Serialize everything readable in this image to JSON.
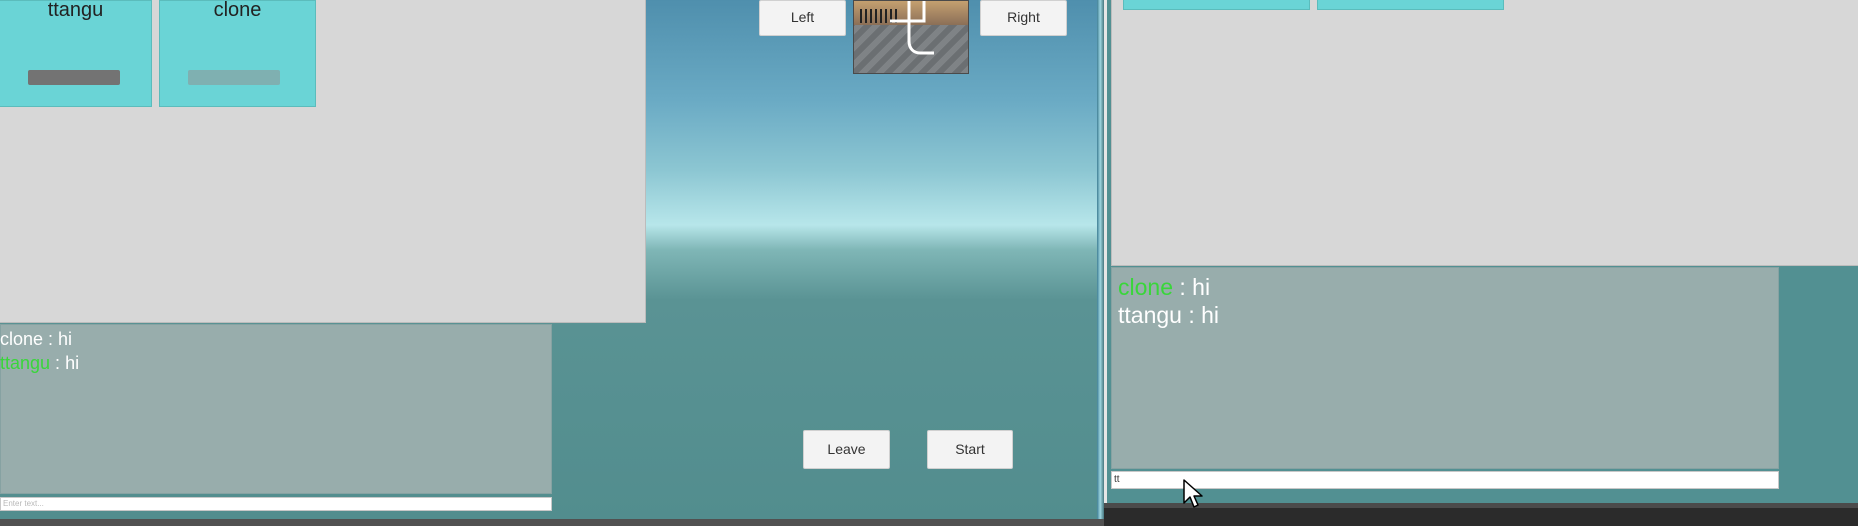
{
  "left_window": {
    "players": [
      {
        "name": "ttangu",
        "bar_color": "#737373"
      },
      {
        "name": "clone",
        "bar_color": "#7fb0b1"
      }
    ],
    "buttons": {
      "left": "Left",
      "right": "Right",
      "leave": "Leave",
      "start": "Start"
    },
    "chat": {
      "messages": [
        {
          "user": "clone",
          "sep": " : ",
          "text": "hi",
          "user_color": "#ffffff"
        },
        {
          "user": "ttangu",
          "sep": " : ",
          "text": "hi",
          "user_color": "#39d63a"
        }
      ],
      "input_placeholder": "Enter text..."
    }
  },
  "right_window": {
    "chat": {
      "messages": [
        {
          "user": "clone",
          "sep": " : ",
          "text": "hi",
          "user_color": "#39d63a"
        },
        {
          "user": "ttangu",
          "sep": " : ",
          "text": "hi",
          "user_color": "#ffffff"
        }
      ],
      "input_value": "tt"
    }
  },
  "colors": {
    "card": "#6ad4d6",
    "panel": "#d7d7d7",
    "chat_bg": "#98adac",
    "highlight_name": "#39d63a"
  }
}
